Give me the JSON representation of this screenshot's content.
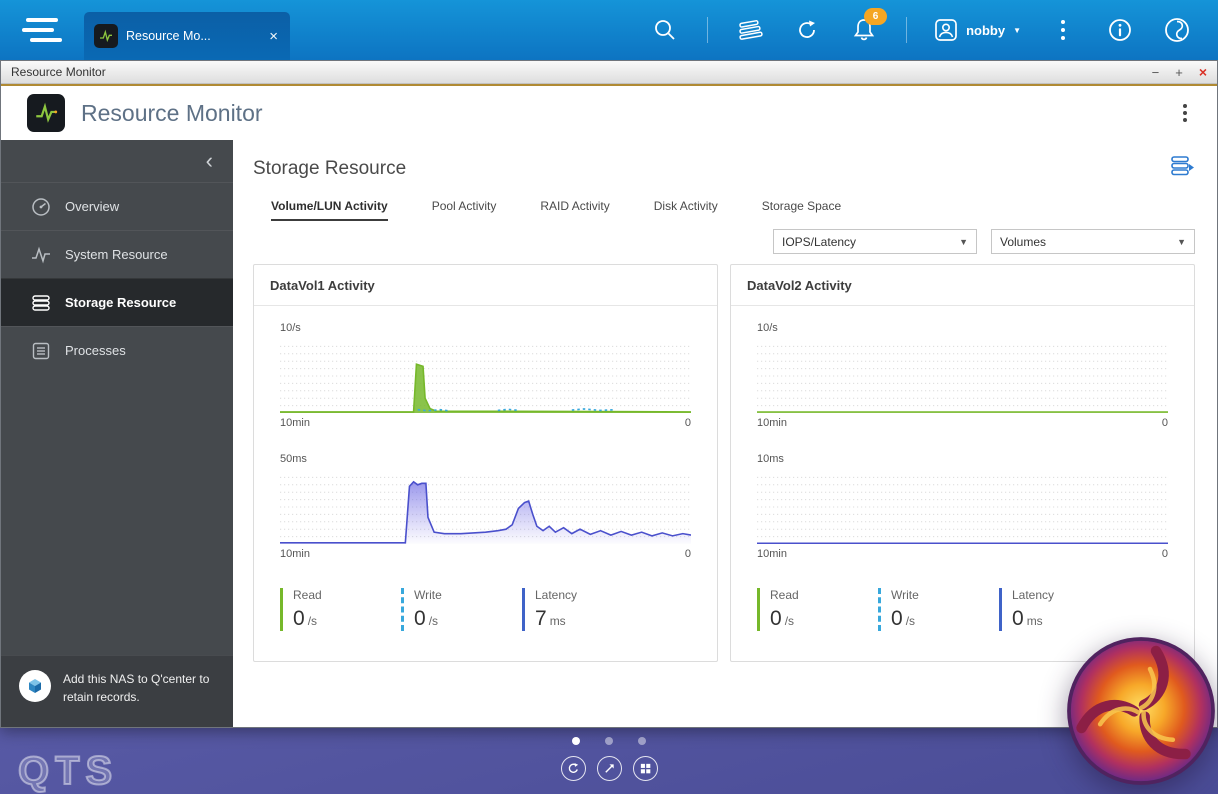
{
  "taskbar": {
    "tab_title": "Resource Mo...",
    "user_name": "nobby",
    "badge_count": "6"
  },
  "window": {
    "title": "Resource Monitor"
  },
  "app_header": {
    "title": "Resource Monitor"
  },
  "sidebar": {
    "items": [
      {
        "label": "Overview"
      },
      {
        "label": "System Resource"
      },
      {
        "label": "Storage Resource"
      },
      {
        "label": "Processes"
      }
    ],
    "qcenter_note": "Add this NAS to Q'center to retain records."
  },
  "content": {
    "heading": "Storage Resource",
    "tabs": [
      {
        "label": "Volume/LUN Activity"
      },
      {
        "label": "Pool Activity"
      },
      {
        "label": "RAID Activity"
      },
      {
        "label": "Disk Activity"
      },
      {
        "label": "Storage Space"
      }
    ],
    "filters": {
      "metric": "IOPS/Latency",
      "scope": "Volumes"
    }
  },
  "cards": [
    {
      "title": "DataVol1 Activity",
      "stats": [
        {
          "label": "Read",
          "value": "0",
          "unit": "/s"
        },
        {
          "label": "Write",
          "value": "0",
          "unit": "/s"
        },
        {
          "label": "Latency",
          "value": "7",
          "unit": "ms"
        }
      ]
    },
    {
      "title": "DataVol2 Activity",
      "stats": [
        {
          "label": "Read",
          "value": "0",
          "unit": "/s"
        },
        {
          "label": "Write",
          "value": "0",
          "unit": "/s"
        },
        {
          "label": "Latency",
          "value": "0",
          "unit": "ms"
        }
      ]
    }
  ],
  "chart_data": [
    {
      "id": "datavol1-iops",
      "type": "area",
      "title": "DataVol1 IOPS (last 10 min)",
      "ymax": 10,
      "ylabel_top": "10/s",
      "xlabel_left": "10min",
      "xlabel_right": "0",
      "series": [
        {
          "name": "Read IOPS",
          "color": "#76b82a",
          "fill": "rgba(118,184,42,0.85)",
          "points": [
            [
              0,
              0.15
            ],
            [
              32.5,
              0.15
            ],
            [
              33.2,
              6.6
            ],
            [
              34.8,
              6.3
            ],
            [
              35.3,
              2.0
            ],
            [
              36.5,
              0.6
            ],
            [
              38,
              0.25
            ],
            [
              100,
              0.15
            ]
          ]
        },
        {
          "name": "Write IOPS",
          "color": "#38a8dc",
          "dashed": true,
          "segments": [
            [
              [
                33.5,
                0.45
              ],
              [
                36,
                0.3
              ],
              [
                39,
                0.45
              ],
              [
                41,
                0.3
              ]
            ],
            [
              [
                53,
                0.35
              ],
              [
                55.5,
                0.5
              ],
              [
                58,
                0.35
              ]
            ],
            [
              [
                71,
                0.4
              ],
              [
                74,
                0.55
              ],
              [
                78,
                0.35
              ],
              [
                81.5,
                0.45
              ]
            ]
          ]
        }
      ]
    },
    {
      "id": "datavol1-latency",
      "type": "area",
      "title": "DataVol1 Latency (last 10 min)",
      "ymax": 50,
      "ylabel_top": "50ms",
      "xlabel_left": "10min",
      "xlabel_right": "0",
      "series": [
        {
          "name": "Latency ms",
          "color": "#4a50cc",
          "gradient": [
            "rgba(100,96,226,0.65)",
            "rgba(120,110,230,0.02)"
          ],
          "points": [
            [
              0,
              0.8
            ],
            [
              30.5,
              0.8
            ],
            [
              31.5,
              39
            ],
            [
              32.5,
              42
            ],
            [
              33.5,
              40
            ],
            [
              34.5,
              41
            ],
            [
              35.5,
              41
            ],
            [
              36,
              18
            ],
            [
              37.5,
              8
            ],
            [
              40,
              7
            ],
            [
              44,
              7
            ],
            [
              47,
              7.5
            ],
            [
              50,
              8
            ],
            [
              53,
              9
            ],
            [
              55,
              10
            ],
            [
              56.5,
              13
            ],
            [
              58,
              24
            ],
            [
              59.5,
              28
            ],
            [
              60.5,
              29
            ],
            [
              61.5,
              20
            ],
            [
              62.5,
              12
            ],
            [
              64,
              9
            ],
            [
              65.5,
              12
            ],
            [
              67,
              8
            ],
            [
              69,
              11
            ],
            [
              71,
              7
            ],
            [
              73,
              10
            ],
            [
              75.5,
              6.5
            ],
            [
              78,
              9
            ],
            [
              80.5,
              6
            ],
            [
              83,
              8.5
            ],
            [
              85.5,
              6
            ],
            [
              88,
              8
            ],
            [
              90.5,
              5.5
            ],
            [
              93,
              7.5
            ],
            [
              95.5,
              5.5
            ],
            [
              98,
              7
            ],
            [
              100,
              6
            ]
          ]
        }
      ]
    },
    {
      "id": "datavol2-iops",
      "type": "line",
      "title": "DataVol2 IOPS (last 10 min)",
      "ymax": 10,
      "ylabel_top": "10/s",
      "xlabel_left": "10min",
      "xlabel_right": "0",
      "series": [
        {
          "name": "Read IOPS",
          "color": "#76b82a",
          "points": [
            [
              0,
              0.12
            ],
            [
              100,
              0.12
            ]
          ]
        }
      ]
    },
    {
      "id": "datavol2-latency",
      "type": "line",
      "title": "DataVol2 Latency (last 10 min)",
      "ymax": 10,
      "ylabel_top": "10ms",
      "xlabel_left": "10min",
      "xlabel_right": "0",
      "series": [
        {
          "name": "Latency ms",
          "color": "#4a50cc",
          "points": [
            [
              0,
              0.1
            ],
            [
              100,
              0.1
            ]
          ]
        }
      ]
    }
  ],
  "desktop": {
    "logo_text": "QTS"
  },
  "icons": {
    "close": "×",
    "minimize": "−",
    "maximize": "+",
    "dropdown_arrow": "▼",
    "user_caret": "▼",
    "collapse_chevron": "‹"
  },
  "colors": {
    "taskbar_blue": "#0d74c2",
    "tab_blue": "#0b5fa6",
    "sidebar_dark": "#45494d",
    "active_item": "#26292c",
    "read_green": "#76b82a",
    "write_blue": "#38a8dc",
    "latency_blue": "#3f63c8",
    "latency_line": "#4a50cc",
    "badge_orange": "#f5a623",
    "close_red": "#d93025",
    "accent_line": "#b08a33",
    "desktop_purple": "#5f61ad"
  }
}
